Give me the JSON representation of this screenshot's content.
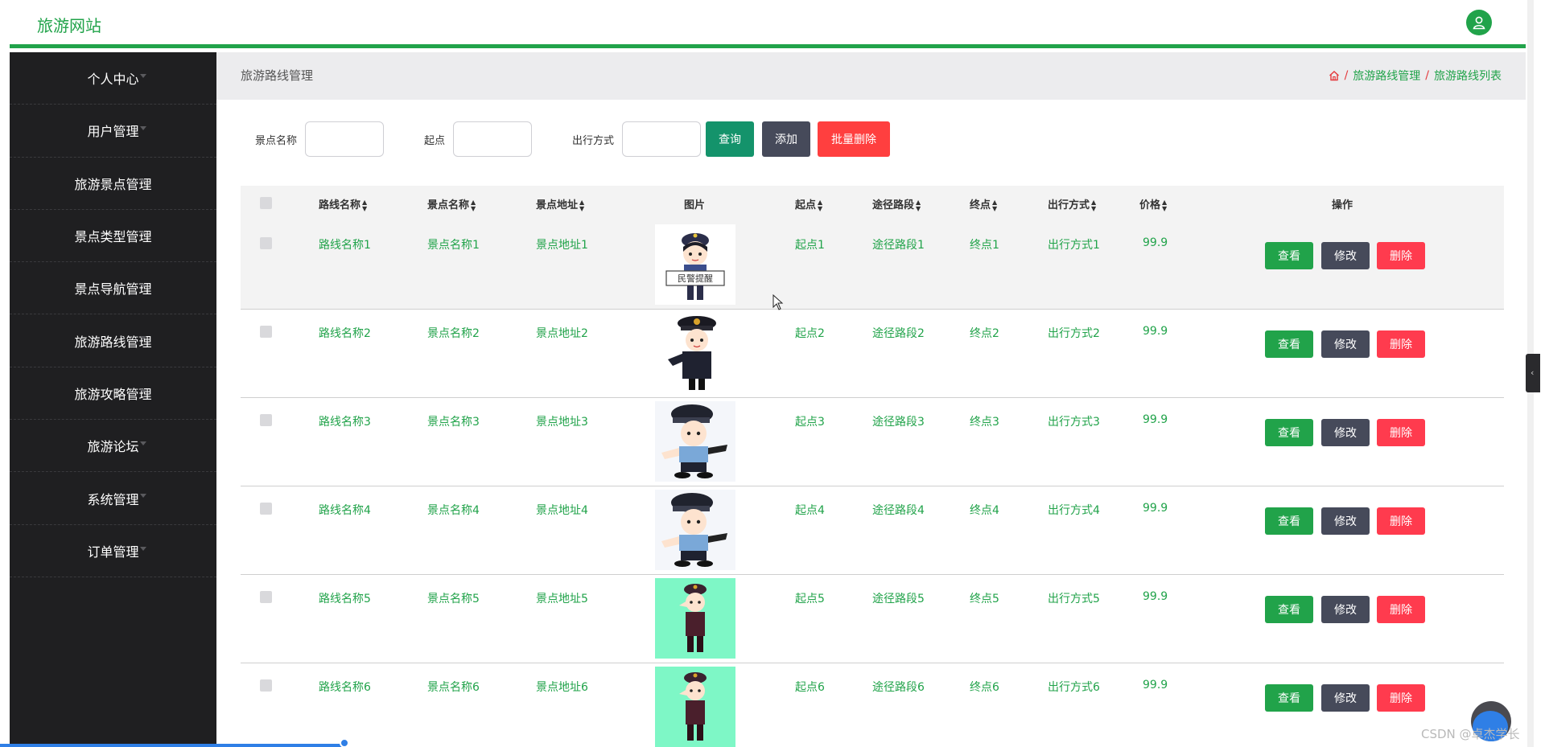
{
  "header": {
    "brand": "旅游网站"
  },
  "sidebar": {
    "items": [
      {
        "label": "个人中心"
      },
      {
        "label": "用户管理"
      },
      {
        "label": "旅游景点管理"
      },
      {
        "label": "景点类型管理"
      },
      {
        "label": "景点导航管理"
      },
      {
        "label": "旅游路线管理"
      },
      {
        "label": "旅游攻略管理"
      },
      {
        "label": "旅游论坛"
      },
      {
        "label": "系统管理"
      },
      {
        "label": "订单管理"
      }
    ]
  },
  "breadcrumb": {
    "title": "旅游路线管理",
    "path": [
      "旅游路线管理",
      "旅游路线列表"
    ],
    "separator": "/"
  },
  "filters": {
    "scenic_name_label": "景点名称",
    "start_label": "起点",
    "travel_mode_label": "出行方式",
    "scenic_name_value": "",
    "start_value": "",
    "travel_mode_value": "",
    "query_label": "查询",
    "add_label": "添加",
    "bulk_delete_label": "批量删除"
  },
  "table": {
    "columns": {
      "route_name": "路线名称",
      "scenic_name": "景点名称",
      "scenic_address": "景点地址",
      "image": "图片",
      "start": "起点",
      "waypoint": "途径路段",
      "end": "终点",
      "travel_mode": "出行方式",
      "price": "价格",
      "actions": "操作"
    },
    "actions": {
      "view": "查看",
      "edit": "修改",
      "delete": "删除"
    },
    "rows": [
      {
        "route_name": "路线名称1",
        "scenic_name": "景点名称1",
        "scenic_address": "景点地址1",
        "start": "起点1",
        "waypoint": "途径路段1",
        "end": "终点1",
        "travel_mode": "出行方式1",
        "price": "99.9",
        "sign": "民警提醒"
      },
      {
        "route_name": "路线名称2",
        "scenic_name": "景点名称2",
        "scenic_address": "景点地址2",
        "start": "起点2",
        "waypoint": "途径路段2",
        "end": "终点2",
        "travel_mode": "出行方式2",
        "price": "99.9"
      },
      {
        "route_name": "路线名称3",
        "scenic_name": "景点名称3",
        "scenic_address": "景点地址3",
        "start": "起点3",
        "waypoint": "途径路段3",
        "end": "终点3",
        "travel_mode": "出行方式3",
        "price": "99.9"
      },
      {
        "route_name": "路线名称4",
        "scenic_name": "景点名称4",
        "scenic_address": "景点地址4",
        "start": "起点4",
        "waypoint": "途径路段4",
        "end": "终点4",
        "travel_mode": "出行方式4",
        "price": "99.9"
      },
      {
        "route_name": "路线名称5",
        "scenic_name": "景点名称5",
        "scenic_address": "景点地址5",
        "start": "起点5",
        "waypoint": "途径路段5",
        "end": "终点5",
        "travel_mode": "出行方式5",
        "price": "99.9"
      },
      {
        "route_name": "路线名称6",
        "scenic_name": "景点名称6",
        "scenic_address": "景点地址6",
        "start": "起点6",
        "waypoint": "途径路段6",
        "end": "终点6",
        "travel_mode": "出行方式6",
        "price": "99.9"
      }
    ]
  },
  "watermark": "CSDN @卓杰学长",
  "colors": {
    "accent": "#21a34a",
    "sidebar_bg": "#1f1f21",
    "delete": "#ff3b4e",
    "edit": "#464a5a",
    "query": "#14936b"
  },
  "icons": {
    "home": "home-icon",
    "user": "user-icon",
    "collapse": "chevron-left-icon"
  }
}
